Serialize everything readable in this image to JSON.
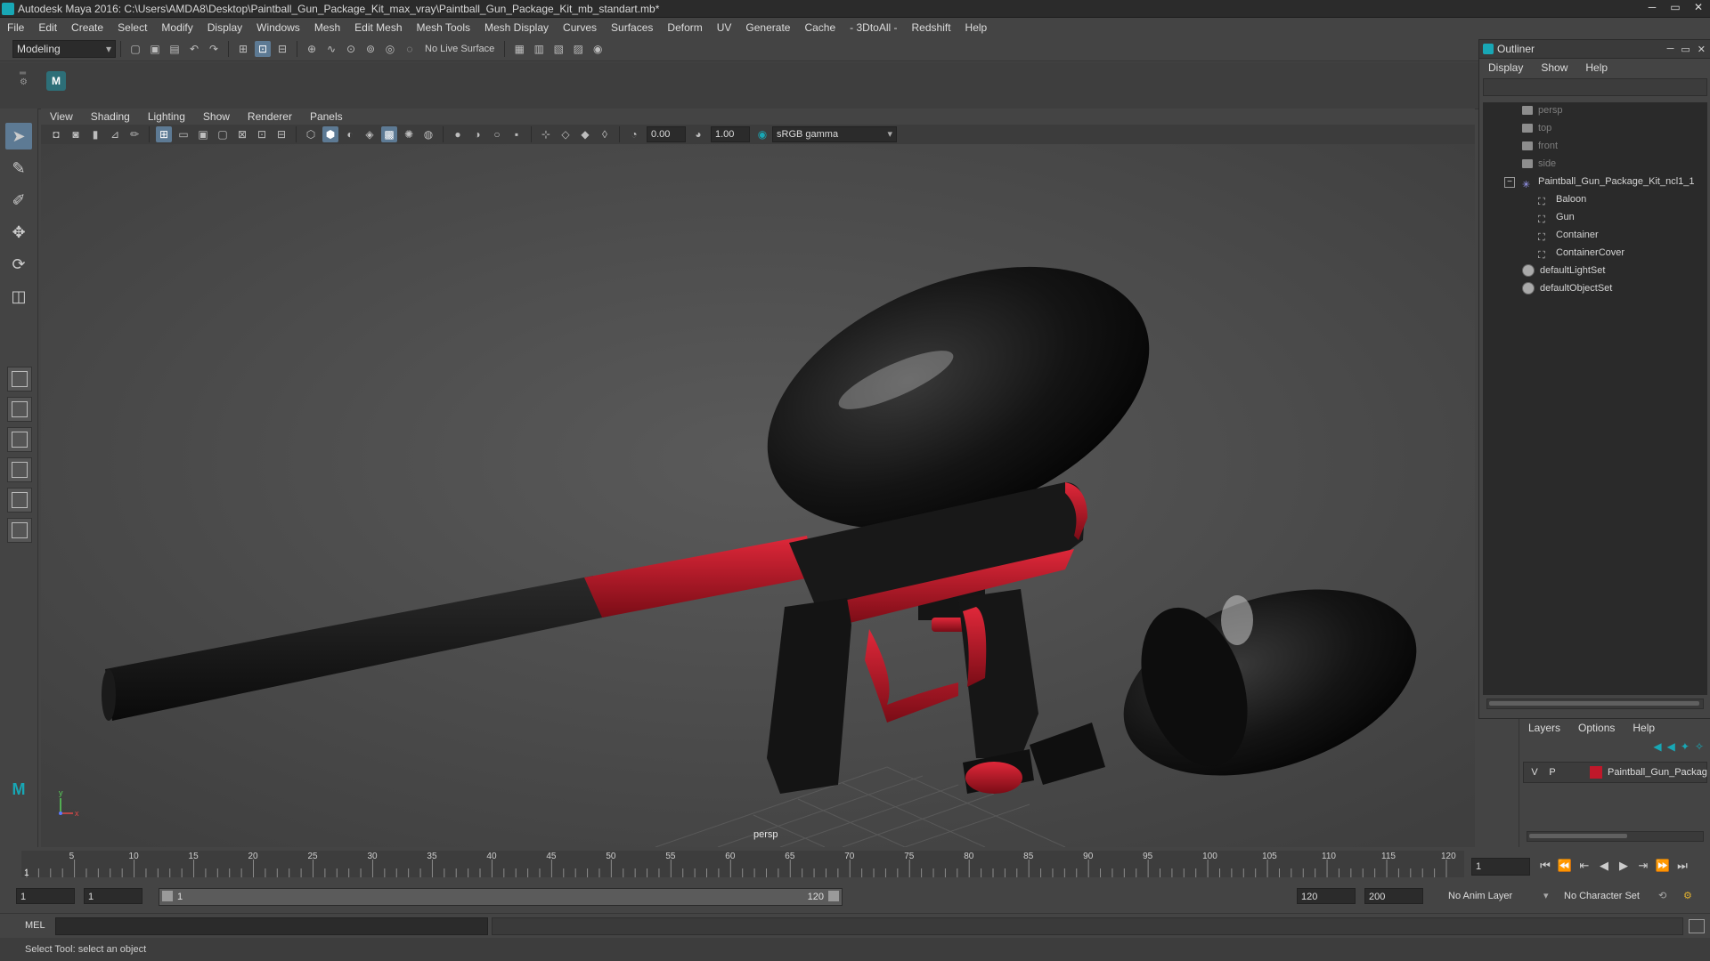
{
  "window": {
    "title": "Autodesk Maya 2016: C:\\Users\\AMDA8\\Desktop\\Paintball_Gun_Package_Kit_max_vray\\Paintball_Gun_Package_Kit_mb_standart.mb*",
    "min": "─",
    "max": "▭",
    "close": "✕"
  },
  "menubar": [
    "File",
    "Edit",
    "Create",
    "Select",
    "Modify",
    "Display",
    "Windows",
    "Mesh",
    "Edit Mesh",
    "Mesh Tools",
    "Mesh Display",
    "Curves",
    "Surfaces",
    "Deform",
    "UV",
    "Generate",
    "Cache",
    "- 3DtoAll -",
    "Redshift",
    "Help"
  ],
  "statusline": {
    "mode": "Modeling",
    "live_surface": "No Live Surface"
  },
  "viewport": {
    "menu": [
      "View",
      "Shading",
      "Lighting",
      "Show",
      "Renderer",
      "Panels"
    ],
    "exposure": "0.00",
    "gamma_value": "1.00",
    "color_space": "sRGB gamma",
    "camera": "persp",
    "axis": {
      "y": "y",
      "x": "x"
    }
  },
  "outliner": {
    "title": "Outliner",
    "menu": [
      "Display",
      "Show",
      "Help"
    ],
    "items": [
      {
        "label": "persp",
        "type": "camera",
        "dim": true
      },
      {
        "label": "top",
        "type": "camera",
        "dim": true
      },
      {
        "label": "front",
        "type": "camera",
        "dim": true
      },
      {
        "label": "side",
        "type": "camera",
        "dim": true
      },
      {
        "label": "Paintball_Gun_Package_Kit_ncl1_1",
        "type": "group",
        "dim": false,
        "expander": "−"
      },
      {
        "label": "Baloon",
        "type": "mesh",
        "dim": false
      },
      {
        "label": "Gun",
        "type": "mesh",
        "dim": false
      },
      {
        "label": "Container",
        "type": "mesh",
        "dim": false
      },
      {
        "label": "ContainerCover",
        "type": "mesh",
        "dim": false
      },
      {
        "label": "defaultLightSet",
        "type": "set",
        "dim": false
      },
      {
        "label": "defaultObjectSet",
        "type": "set",
        "dim": false
      }
    ]
  },
  "layers": {
    "menu": [
      "Layers",
      "Options",
      "Help"
    ],
    "row": {
      "v": "V",
      "p": "P",
      "name": "Paintball_Gun_Packag",
      "color": "#c0182a"
    }
  },
  "timeline": {
    "start": 1,
    "end": 120,
    "labels": [
      5,
      10,
      15,
      20,
      25,
      30,
      35,
      40,
      45,
      50,
      55,
      60,
      65,
      70,
      75,
      80,
      85,
      90,
      95,
      100,
      105,
      110,
      115,
      120
    ],
    "current_frame_marker": "1",
    "current_frame": "1"
  },
  "range": {
    "start_time": "1",
    "playback_start": "1",
    "range_start": "1",
    "range_end": "120",
    "playback_end": "120",
    "end_time": "200",
    "anim_layer": "No Anim Layer",
    "char_set": "No Character Set"
  },
  "command": {
    "lang": "MEL"
  },
  "help_line": "Select Tool: select an object",
  "colors": {
    "accent": "#5d7a94",
    "gun_red": "#c0182a",
    "maya_teal": "#18a7b5"
  }
}
